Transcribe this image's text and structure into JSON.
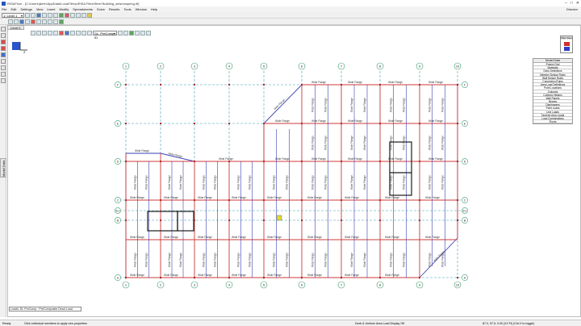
{
  "window": {
    "title": "RISAFloor - [C:\\Users\\jkern\\AppData\\Local\\Temp\\RISA Files\\Steel Building_seismospring.rfl]",
    "min": "–",
    "max": "□",
    "close": "✕"
  },
  "menu": [
    "File",
    "Edit",
    "Settings",
    "View",
    "Insert",
    "Modify",
    "Spreadsheets",
    "Solve",
    "Results",
    "Tools",
    "Window",
    "Help"
  ],
  "menu_right": "Director",
  "toolbar": {
    "level_select": "1: Level 1",
    "load_select": "DL: PreComp - ID",
    "doc_tab": "Level 1"
  },
  "left_tab": "Model Data",
  "legend": {
    "header": "Plan View"
  },
  "properties_panel": {
    "header": "Model Data",
    "items": [
      "Project Grid",
      "Materials",
      "Deck Definitions",
      "Member Design Rules",
      "Wall Design Rules",
      "Connection Rules",
      "Area Load Definitions",
      "Point Locations",
      "Columns",
      "Collector Beams",
      "Wall Panels",
      "Beams",
      "Diaphragms",
      "Point Loads",
      "Line Loads",
      "Tapered Area Loads",
      "Load Combinations",
      "Floors"
    ]
  },
  "grid": {
    "columns": [
      "1",
      "2",
      "3",
      "4",
      "5",
      "6",
      "7",
      "8",
      "9",
      "10"
    ],
    "rows": [
      "F",
      "E",
      "D",
      "C",
      "B.1",
      "B",
      "A"
    ]
  },
  "member_label": "Wide Flange",
  "loads_box": "Loads: DL PreComp : PreComposite Dead Load",
  "status": {
    "ready": "Ready",
    "hint": "Click individual members to apply new properties",
    "display": "Deck & Uniform Area Load Display Off",
    "coords": "87.0, 57.5, 0.00 (X2 Ft)   (Ctrl-V to toggle)"
  },
  "colors": {
    "beam": "#d03a3a",
    "joist": "#3a3fb3",
    "grid": "#3f9bb5",
    "opening": "#1a1a1a"
  }
}
